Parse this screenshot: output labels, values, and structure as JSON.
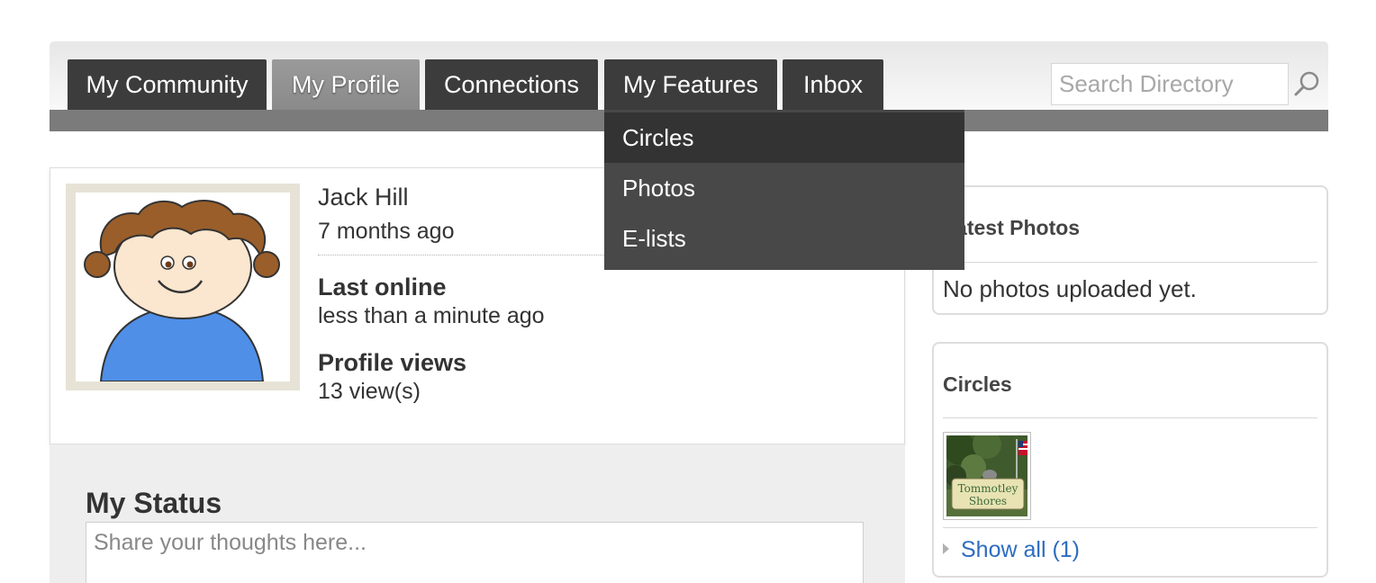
{
  "nav": {
    "tabs": [
      {
        "label": "My Community",
        "active": false
      },
      {
        "label": "My Profile",
        "active": true
      },
      {
        "label": "Connections",
        "active": false
      },
      {
        "label": "My Features",
        "active": false
      },
      {
        "label": "Inbox",
        "active": false
      }
    ],
    "search": {
      "placeholder": "Search Directory",
      "icon": "search-icon"
    },
    "dropdown": {
      "items": [
        {
          "label": "Circles",
          "highlighted": true
        },
        {
          "label": "Photos",
          "highlighted": false
        },
        {
          "label": "E-lists",
          "highlighted": false
        }
      ]
    }
  },
  "profile": {
    "name": "Jack Hill",
    "joined": "7 months ago",
    "last_online_label": "Last online",
    "last_online_value": "less than a minute ago",
    "views_label": "Profile views",
    "views_value": "13 view(s)"
  },
  "status": {
    "title": "My Status",
    "placeholder": "Share your thoughts here..."
  },
  "sidebar": {
    "latest_photos": {
      "title": "Latest Photos",
      "empty_text": "No photos uploaded yet."
    },
    "circles": {
      "title": "Circles",
      "thumb_text_line1": "Tommotley",
      "thumb_text_line2": "Shores",
      "show_all": "Show all (1)"
    }
  },
  "colors": {
    "tab_bg": "#3c3c3c",
    "tab_active_bg": "#8f8f8f",
    "strip": "#7b7b7b",
    "dropdown_bg": "#484848",
    "dropdown_hover": "#333333",
    "link": "#2d6cc0"
  }
}
